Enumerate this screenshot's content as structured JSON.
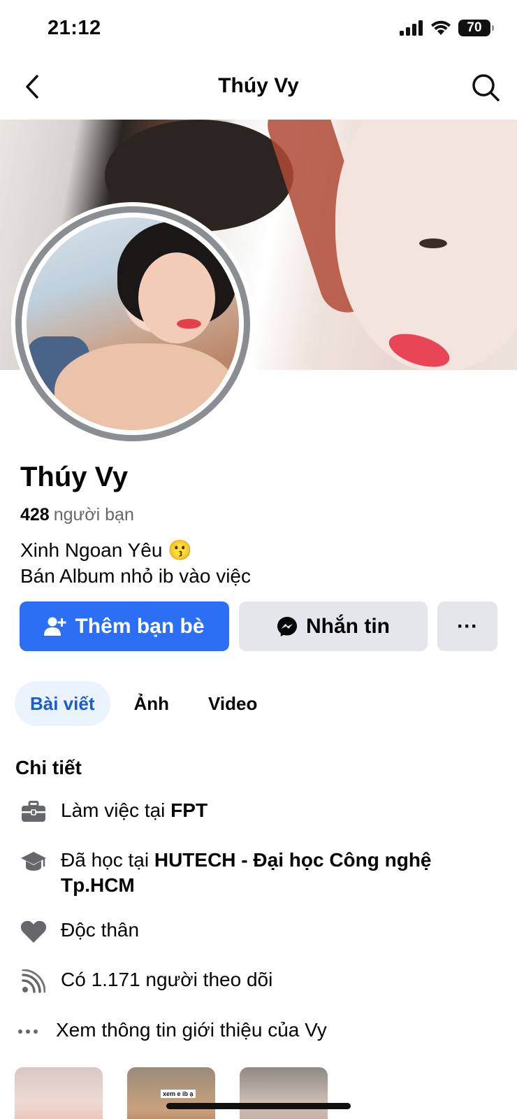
{
  "status_bar": {
    "time": "21:12",
    "battery": "70"
  },
  "nav": {
    "title": "Thúy Vy"
  },
  "profile": {
    "name": "Thúy Vy",
    "friend_count": "428",
    "friend_label": "người bạn",
    "bio_line1": "Xinh Ngoan Yêu 😗",
    "bio_line2": "Bán Album nhỏ ib vào việc"
  },
  "actions": {
    "add_friend": "Thêm bạn bè",
    "message": "Nhắn tin",
    "more": "···"
  },
  "tabs": [
    {
      "label": "Bài viết",
      "active": true
    },
    {
      "label": "Ảnh",
      "active": false
    },
    {
      "label": "Video",
      "active": false
    }
  ],
  "details": {
    "title": "Chi tiết",
    "work_prefix": "Làm việc tại ",
    "work_place": "FPT",
    "edu_prefix": "Đã học tại ",
    "edu_place": "HUTECH - Đại học Công nghệ Tp.HCM",
    "relationship": "Độc thân",
    "followers": "Có 1.171 người theo dõi",
    "see_about": "Xem thông tin giới thiệu của Vy"
  },
  "thumbnails": {
    "caption": "xem e ib ạ"
  }
}
